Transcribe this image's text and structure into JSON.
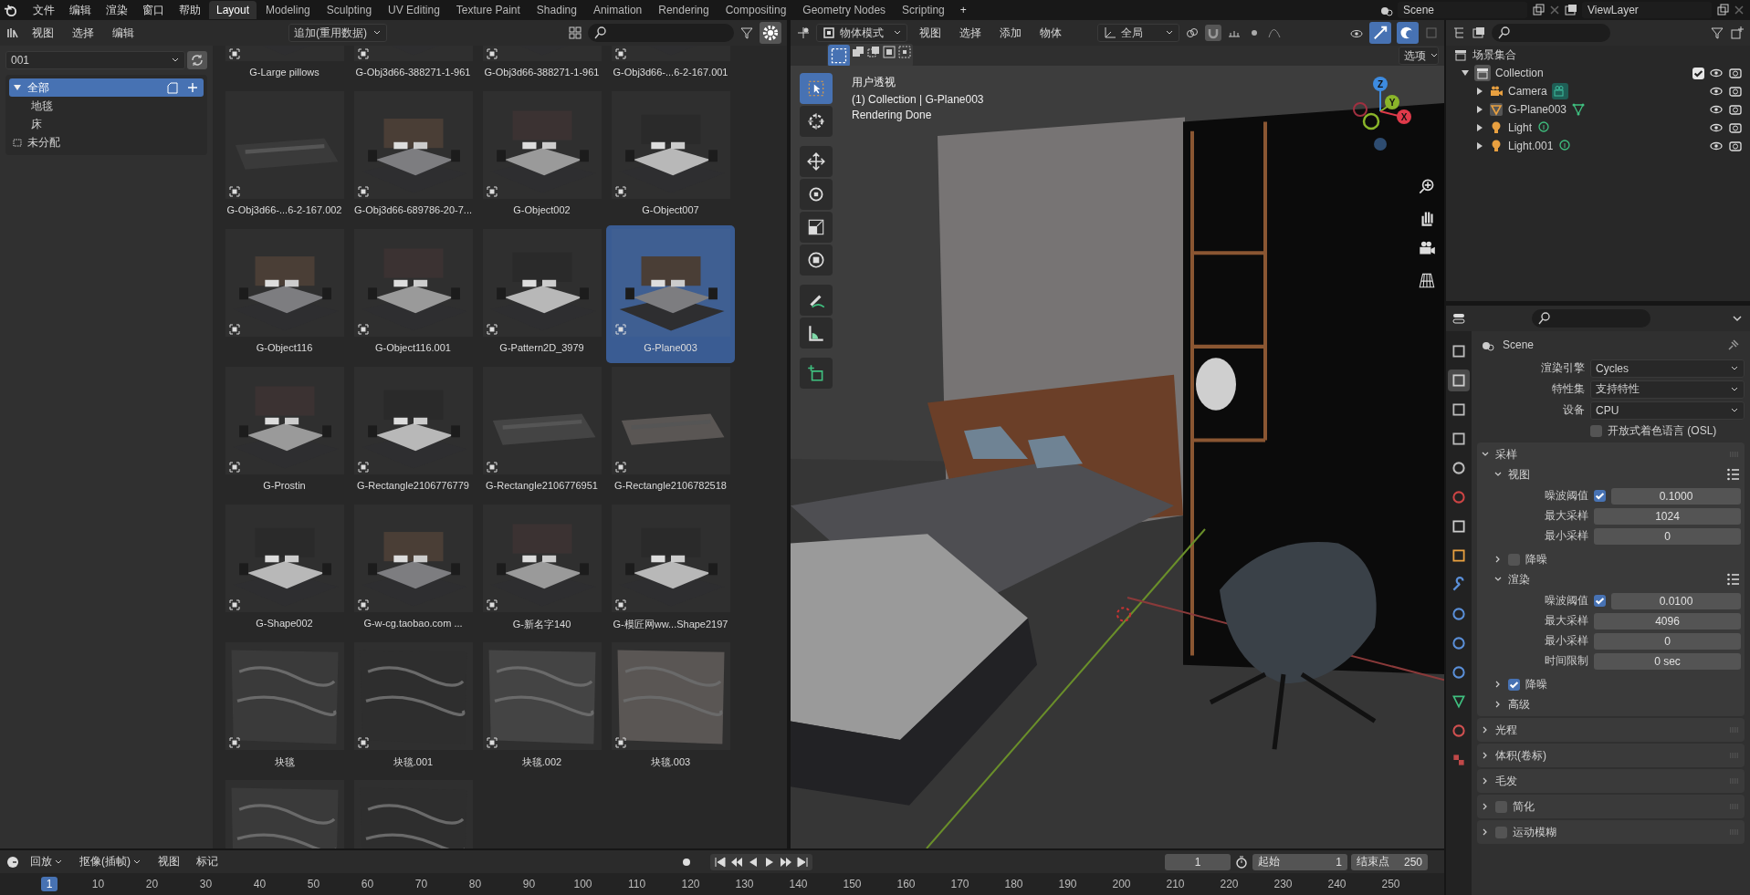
{
  "top_bar": {
    "menus": [
      "文件",
      "编辑",
      "渲染",
      "窗口",
      "帮助"
    ],
    "workspaces": [
      {
        "label": "Layout",
        "selected": true
      },
      {
        "label": "Modeling",
        "selected": false
      },
      {
        "label": "Sculpting",
        "selected": false
      },
      {
        "label": "UV Editing",
        "selected": false
      },
      {
        "label": "Texture Paint",
        "selected": false
      },
      {
        "label": "Shading",
        "selected": false
      },
      {
        "label": "Animation",
        "selected": false
      },
      {
        "label": "Rendering",
        "selected": false
      },
      {
        "label": "Compositing",
        "selected": false
      },
      {
        "label": "Geometry Nodes",
        "selected": false
      },
      {
        "label": "Scripting",
        "selected": false
      }
    ],
    "add_tab": "+",
    "scene": "Scene",
    "view_layer": "ViewLayer"
  },
  "asset_browser": {
    "menus": [
      "视图",
      "选择",
      "编辑"
    ],
    "import_mode": "追加(重用数据)",
    "library": "001",
    "catalogs": [
      {
        "label": "全部",
        "selected": true,
        "expanded": true,
        "children": [
          {
            "label": "地毯",
            "selected": false
          },
          {
            "label": "床",
            "selected": false
          }
        ]
      },
      {
        "label": "未分配",
        "selected": false
      }
    ],
    "assets": [
      {
        "name": "G-Large pillows",
        "selected": false
      },
      {
        "name": "G-Obj3d66-388271-1-961",
        "selected": false
      },
      {
        "name": "G-Obj3d66-388271-1-961",
        "selected": false
      },
      {
        "name": "G-Obj3d66-...6-2-167.001",
        "selected": false
      },
      {
        "name": "G-Obj3d66-...6-2-167.002",
        "selected": false
      },
      {
        "name": "G-Obj3d66-689786-20-7...",
        "selected": false
      },
      {
        "name": "G-Object002",
        "selected": false
      },
      {
        "name": "G-Object007",
        "selected": false
      },
      {
        "name": "G-Object116",
        "selected": false
      },
      {
        "name": "G-Object116.001",
        "selected": false
      },
      {
        "name": "G-Pattern2D_3979",
        "selected": false
      },
      {
        "name": "G-Plane003",
        "selected": true
      },
      {
        "name": "G-Prostin",
        "selected": false
      },
      {
        "name": "G-Rectangle2106776779",
        "selected": false
      },
      {
        "name": "G-Rectangle2106776951",
        "selected": false
      },
      {
        "name": "G-Rectangle2106782518",
        "selected": false
      },
      {
        "name": "G-Shape002",
        "selected": false
      },
      {
        "name": "G-w-cg.taobao.com ...",
        "selected": false
      },
      {
        "name": "G-新名字140",
        "selected": false
      },
      {
        "name": "G-模匠网ww...Shape2197",
        "selected": false
      },
      {
        "name": "块毯",
        "selected": false
      },
      {
        "name": "块毯.001",
        "selected": false
      },
      {
        "name": "块毯.002",
        "selected": false
      },
      {
        "name": "块毯.003",
        "selected": false
      },
      {
        "selected": false
      },
      {
        "selected": false
      }
    ]
  },
  "viewport": {
    "mode": "物体模式",
    "menus": [
      "视图",
      "选择",
      "添加",
      "物体"
    ],
    "orientation": "全局",
    "options": "选项",
    "tools": [
      {
        "kind": "select",
        "selected": true
      },
      {
        "kind": "cursor",
        "selected": false
      },
      {
        "kind": "move",
        "selected": false
      },
      {
        "kind": "rotate",
        "selected": false
      },
      {
        "kind": "scale",
        "selected": false
      },
      {
        "kind": "transform",
        "selected": false
      },
      {
        "kind": "annotate",
        "selected": false
      },
      {
        "kind": "measure",
        "selected": false
      },
      {
        "kind": "add-cube",
        "selected": false
      }
    ],
    "info": [
      "用户透视",
      "(1) Collection | G-Plane003",
      "Rendering Done"
    ],
    "gizmo": {
      "x": "X",
      "y": "Y",
      "z": "Z"
    }
  },
  "outliner": {
    "root": "场景集合",
    "items": [
      {
        "name": "Collection",
        "kind": "collection",
        "checked": true,
        "expanded": true,
        "children": [
          {
            "name": "Camera",
            "kind": "camera",
            "expanded": false
          },
          {
            "name": "G-Plane003",
            "kind": "mesh",
            "expanded": false
          },
          {
            "name": "Light",
            "kind": "light",
            "expanded": false
          },
          {
            "name": "Light.001",
            "kind": "light",
            "expanded": false
          }
        ]
      }
    ]
  },
  "properties": {
    "tabs": [
      {
        "kind": "tool",
        "selected": false
      },
      {
        "kind": "render",
        "selected": true
      },
      {
        "kind": "output",
        "selected": false
      },
      {
        "kind": "view-layer",
        "selected": false
      },
      {
        "kind": "scene",
        "selected": false
      },
      {
        "kind": "world",
        "selected": false
      },
      {
        "kind": "collection",
        "selected": false
      },
      {
        "kind": "object",
        "selected": false
      },
      {
        "kind": "modifier",
        "selected": false
      },
      {
        "kind": "particles",
        "selected": false
      },
      {
        "kind": "physics",
        "selected": false
      },
      {
        "kind": "constraints",
        "selected": false
      },
      {
        "kind": "data",
        "selected": false
      },
      {
        "kind": "material",
        "selected": false
      },
      {
        "kind": "texture",
        "selected": false
      }
    ],
    "header": "Scene",
    "fields": [
      {
        "label": "渲染引擎",
        "value": "Cycles"
      },
      {
        "label": "特性集",
        "value": "支持特性"
      },
      {
        "label": "设备",
        "value": "CPU"
      }
    ],
    "osl": {
      "label": "开放式着色语言 (OSL)",
      "checked": false
    },
    "panels": [
      {
        "title": "采样",
        "kind": "plain",
        "expanded": true,
        "subpanels": [
          {
            "title": "视图",
            "kind": "group",
            "expanded": true,
            "rows": [
              {
                "label": "噪波阈值",
                "kind": "check-number",
                "checked": true,
                "value": "0.1000"
              },
              {
                "label": "最大采样",
                "kind": "number",
                "value": "1024"
              },
              {
                "label": "最小采样",
                "kind": "number",
                "value": "0"
              }
            ]
          },
          {
            "title": "降噪",
            "kind": "toggle",
            "checked": false,
            "expanded": false
          },
          {
            "title": "渲染",
            "kind": "group",
            "expanded": true,
            "rows": [
              {
                "label": "噪波阈值",
                "kind": "check-number",
                "checked": true,
                "value": "0.0100"
              },
              {
                "label": "最大采样",
                "kind": "number",
                "value": "4096"
              },
              {
                "label": "最小采样",
                "kind": "number",
                "value": "0"
              },
              {
                "label": "时间限制",
                "kind": "number",
                "value": "0 sec"
              }
            ]
          },
          {
            "title": "降噪",
            "kind": "toggle",
            "checked": true,
            "expanded": false
          },
          {
            "title": "高级",
            "kind": "plain",
            "expanded": false
          }
        ]
      },
      {
        "title": "光程",
        "kind": "plain",
        "expanded": false
      },
      {
        "title": "体积(卷标)",
        "kind": "plain",
        "expanded": false
      },
      {
        "title": "毛发",
        "kind": "plain",
        "expanded": false
      },
      {
        "title": "简化",
        "kind": "toggle",
        "checked": false,
        "expanded": false
      },
      {
        "title": "运动模糊",
        "kind": "toggle",
        "checked": false,
        "expanded": false
      }
    ]
  },
  "timeline": {
    "menus": [
      "回放",
      "抠像(插帧)",
      "视图",
      "标记"
    ],
    "current_frame": "1",
    "start_label": "起始",
    "start": "1",
    "end_label": "结束点",
    "end": "250",
    "ruler": [
      {
        "label": "1",
        "selected": true
      },
      {
        "label": "10",
        "selected": false
      },
      {
        "label": "20",
        "selected": false
      },
      {
        "label": "30",
        "selected": false
      },
      {
        "label": "40",
        "selected": false
      },
      {
        "label": "50",
        "selected": false
      },
      {
        "label": "60",
        "selected": false
      },
      {
        "label": "70",
        "selected": false
      },
      {
        "label": "80",
        "selected": false
      },
      {
        "label": "90",
        "selected": false
      },
      {
        "label": "100",
        "selected": false
      },
      {
        "label": "110",
        "selected": false
      },
      {
        "label": "120",
        "selected": false
      },
      {
        "label": "130",
        "selected": false
      },
      {
        "label": "140",
        "selected": false
      },
      {
        "label": "150",
        "selected": false
      },
      {
        "label": "160",
        "selected": false
      },
      {
        "label": "170",
        "selected": false
      },
      {
        "label": "180",
        "selected": false
      },
      {
        "label": "190",
        "selected": false
      },
      {
        "label": "200",
        "selected": false
      },
      {
        "label": "210",
        "selected": false
      },
      {
        "label": "220",
        "selected": false
      },
      {
        "label": "230",
        "selected": false
      },
      {
        "label": "240",
        "selected": false
      },
      {
        "label": "250",
        "selected": false
      }
    ]
  }
}
